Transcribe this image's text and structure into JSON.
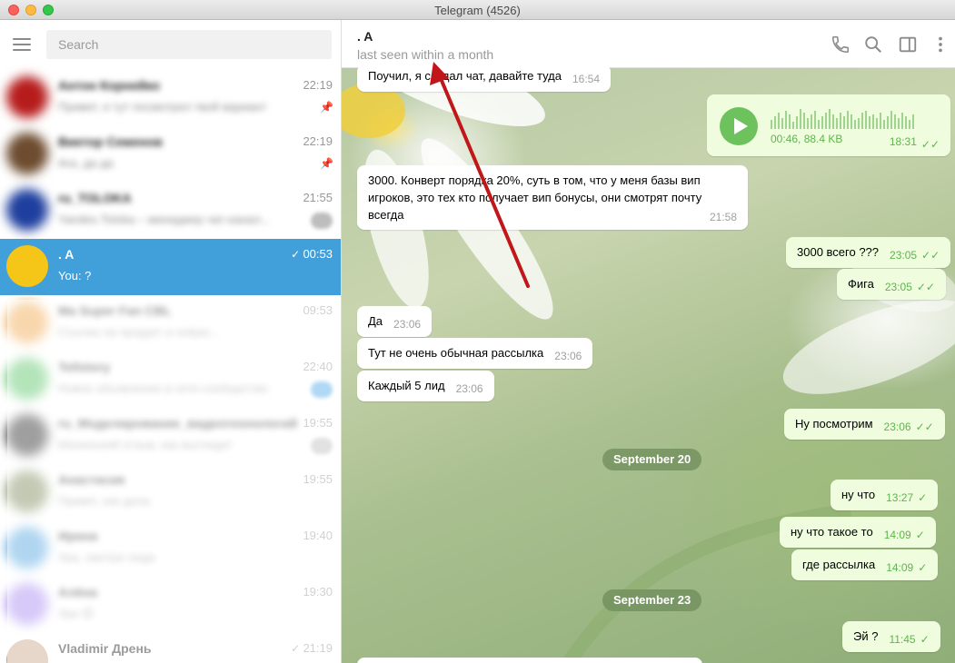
{
  "window": {
    "title": "Telegram (4526)"
  },
  "sidebar": {
    "search_placeholder": "Search",
    "chats": [
      {
        "name": "Антон Корнейко",
        "time": "22:19",
        "preview": "Привет, я тут посмотрел твой вариант",
        "blurred": true,
        "avatar_color": "#b71c1c",
        "pinned": true
      },
      {
        "name": "Виктор Семенов",
        "time": "22:19",
        "preview": "Ага, да да",
        "blurred": true,
        "avatar_color": "#6d4c2f",
        "pinned": true
      },
      {
        "name": "ru_TOLOKA",
        "time": "21:55",
        "preview": "Yandex.Toloka – менеджер чат-канал...",
        "blurred": true,
        "avatar_color": "#1e3f9e",
        "badge": true
      },
      {
        "name": ". A",
        "time": "00:53",
        "preview": "You: ?",
        "blurred": false,
        "active": true,
        "avatar_color": "#f5c518"
      },
      {
        "name": "Ma Super Fan CBL",
        "time": "09:53",
        "preview": "Ссылка на продукт и новую...",
        "blurred": true,
        "avatar_color": "#f0a64a"
      },
      {
        "name": "Tellstory",
        "time": "22:40",
        "preview": "Новое объявление в сети сообщество",
        "blurred": true,
        "avatar_color": "#58c466",
        "badge": true,
        "badge_blue": true
      },
      {
        "name": "ru_Моделирование_видеотехнологий",
        "time": "19:55",
        "preview": "Маленький отзыв, как выглядит",
        "blurred": true,
        "avatar_color": "#2b2b2b",
        "badge": true
      },
      {
        "name": "Анастасия",
        "time": "19:55",
        "preview": "Привет, как дела",
        "blurred": true,
        "avatar_color": "#7b8a5a"
      },
      {
        "name": "Ирина",
        "time": "19:40",
        "preview": "Ура, смотри сюда",
        "blurred": true,
        "avatar_color": "#4fa3e0"
      },
      {
        "name": "Алёна",
        "time": "19:30",
        "preview": "Ура 😊",
        "blurred": true,
        "avatar_color": "#a688f0"
      },
      {
        "name": "Vladimir Дрень",
        "time": "21:19",
        "preview": "",
        "blurred": false,
        "avatar_color": "#c9a48a"
      }
    ]
  },
  "conversation": {
    "name": ". A",
    "status": "last seen within a month",
    "voice": {
      "duration": "00:46, 88.4 KB",
      "time": "18:31"
    },
    "messages": [
      {
        "dir": "in",
        "text": "Поучил, я создал чат, давайте туда",
        "time": "16:54"
      },
      {
        "dir": "in",
        "lines": [
          "3000. Конверт порядка 20%, суть в том, что у меня базы вип",
          "игроков, это тех кто получает вип бонусы, они смотрят почту",
          "всегда"
        ],
        "time": "21:58"
      },
      {
        "dir": "out",
        "text": "3000 всего ???",
        "time": "23:05"
      },
      {
        "dir": "out",
        "text": "Фига",
        "time": "23:05"
      },
      {
        "dir": "in",
        "text": "Да",
        "time": "23:06"
      },
      {
        "dir": "in",
        "text": "Тут не очень обычная рассылка",
        "time": "23:06"
      },
      {
        "dir": "in",
        "text": "Каждый 5 лид",
        "time": "23:06"
      },
      {
        "dir": "out",
        "text": "Ну посмотрим",
        "time": "23:06"
      },
      {
        "dir": "out",
        "text": "ну что",
        "time": "13:27"
      },
      {
        "dir": "out",
        "text": "ну что такое то",
        "time": "14:09"
      },
      {
        "dir": "out",
        "text": "где рассылка",
        "time": "14:09"
      },
      {
        "dir": "out",
        "text": "Эй ?",
        "time": "11:45"
      }
    ],
    "dates": [
      "September 20",
      "September 23"
    ]
  },
  "colors": {
    "accent": "#419fd9",
    "out_bubble": "#effdde",
    "out_meta": "#5fb44d"
  }
}
